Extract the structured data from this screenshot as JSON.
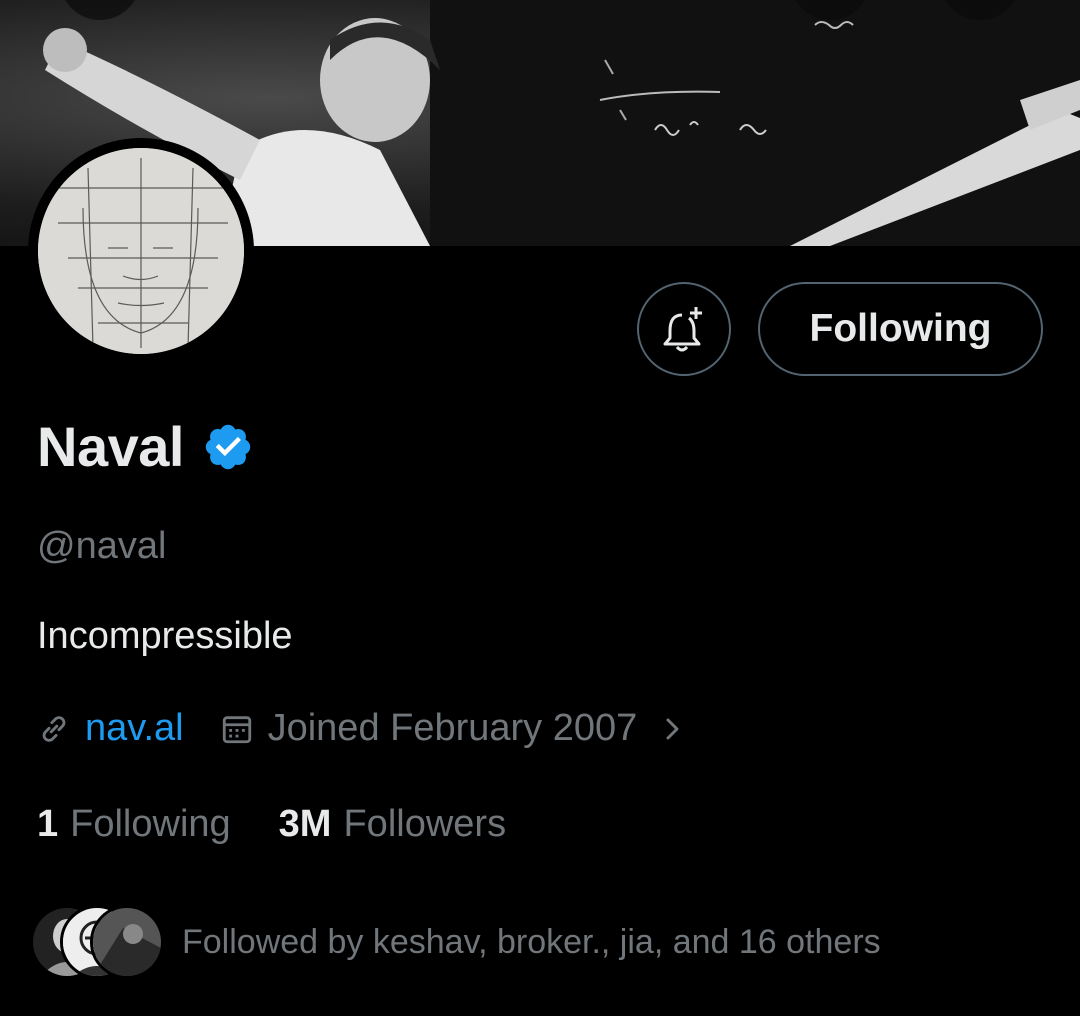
{
  "profile": {
    "name": "Naval",
    "handle": "@naval",
    "bio": "Incompressible",
    "website": "nav.al",
    "joined": "Joined February 2007",
    "verified": true
  },
  "stats": {
    "following_count": "1",
    "following_label": "Following",
    "followers_count": "3M",
    "followers_label": "Followers"
  },
  "actions": {
    "follow_button_label": "Following"
  },
  "followed_by": {
    "text": "Followed by keshav, broker., jia, and 16 others"
  },
  "icons": {
    "notification": "bell-plus-icon",
    "verified": "verified-badge-icon",
    "link": "link-icon",
    "calendar": "calendar-icon",
    "chevron": "chevron-right-icon"
  },
  "colors": {
    "background": "#000000",
    "accent": "#1d9bf0",
    "muted_text": "#71767b",
    "primary_text": "#e7e9ea",
    "border": "#536471"
  }
}
